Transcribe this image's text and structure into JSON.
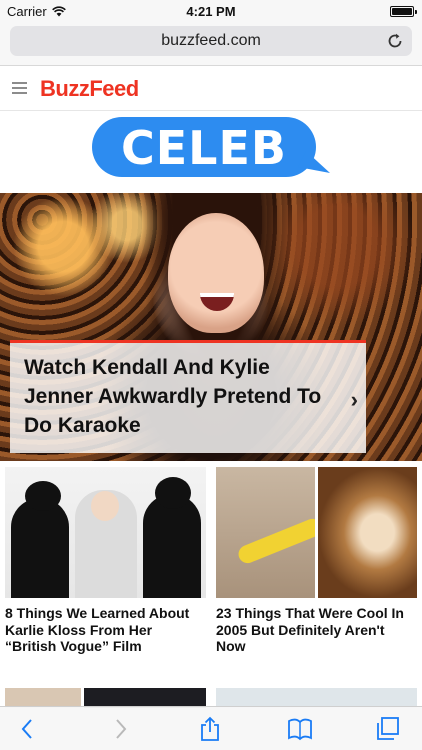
{
  "status_bar": {
    "carrier": "Carrier",
    "time": "4:21 PM",
    "icons": [
      "wifi-icon",
      "battery-icon"
    ]
  },
  "browser": {
    "url": "buzzfeed.com",
    "reload_icon": "reload-icon"
  },
  "site": {
    "logo_text": "BuzzFeed",
    "menu_icon": "hamburger-icon",
    "section_logo_text": "CELEB",
    "brand_color": "#ee3322",
    "section_color": "#2d8cf0"
  },
  "hero": {
    "title": "Watch Kendall And Kylie Jenner Awkwardly Pretend To Do Karaoke",
    "chevron_icon": "chevron-right-icon"
  },
  "articles": [
    {
      "title": "8 Things We Learned About Karlie Kloss From Her “British Vogue” Film"
    },
    {
      "title": "23 Things That Were Cool In 2005 But Definitely Aren't Now"
    }
  ],
  "toolbar": {
    "buttons": [
      "back-icon",
      "forward-icon",
      "share-icon",
      "bookmarks-icon",
      "tabs-icon"
    ],
    "accent": "#1a7cf5"
  }
}
